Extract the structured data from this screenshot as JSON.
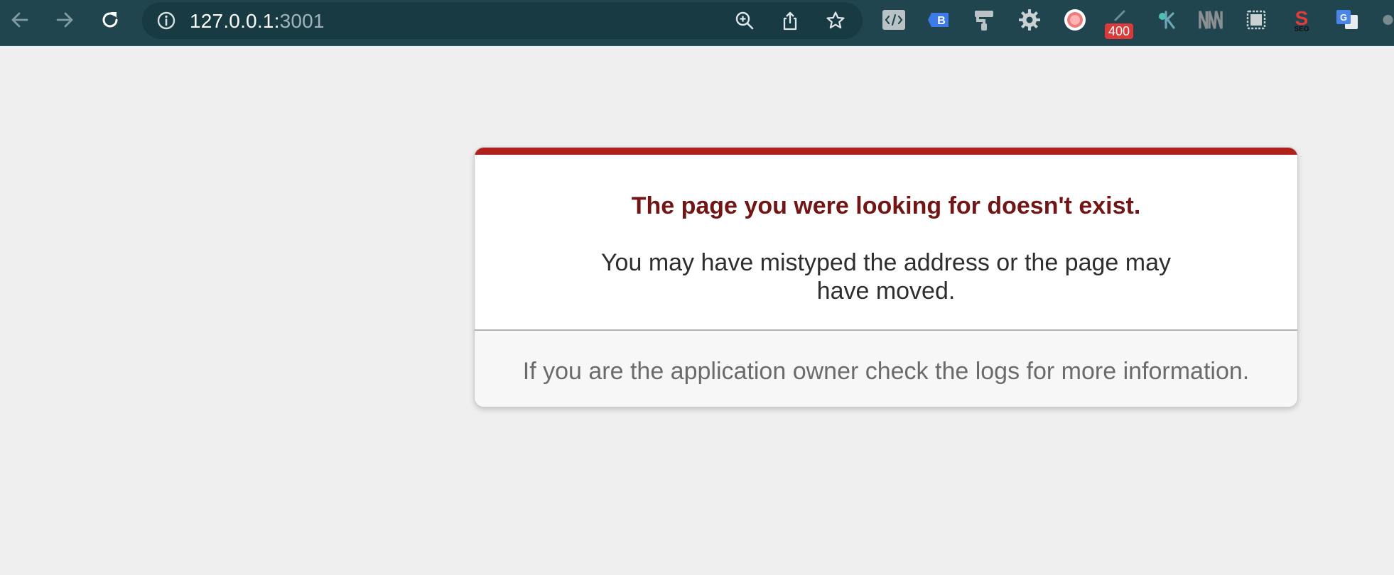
{
  "browser": {
    "address_host": "127.0.0.1:",
    "address_port": "3001",
    "nav": {
      "back_icon": "arrow-left-icon",
      "forward_icon": "arrow-right-icon",
      "reload_icon": "reload-icon"
    },
    "omnibox_icons": [
      "info-icon",
      "zoom-icon",
      "share-icon",
      "star-icon"
    ],
    "extensions": [
      {
        "name": "code-extension-icon"
      },
      {
        "name": "b-extension-icon"
      },
      {
        "name": "paint-roller-extension-icon"
      },
      {
        "name": "gear-extension-icon"
      },
      {
        "name": "record-extension-icon"
      },
      {
        "name": "counter-extension-icon",
        "badge": "400"
      },
      {
        "name": "rk-extension-icon"
      },
      {
        "name": "nw-extension-icon"
      },
      {
        "name": "screenshot-extension-icon"
      },
      {
        "name": "seo-extension-icon"
      },
      {
        "name": "translate-extension-icon"
      }
    ],
    "colors": {
      "toolbar": "#21454f",
      "omnibox": "#183a42",
      "badge": "#d93b3b"
    }
  },
  "error_page": {
    "heading": "The page you were looking for doesn't exist.",
    "message": "You may have mistyped the address or the page may have moved.",
    "footnote": "If you are the application owner check the logs for more information.",
    "colors": {
      "accent": "#b0211d",
      "heading": "#721515",
      "background": "#efefef"
    }
  }
}
